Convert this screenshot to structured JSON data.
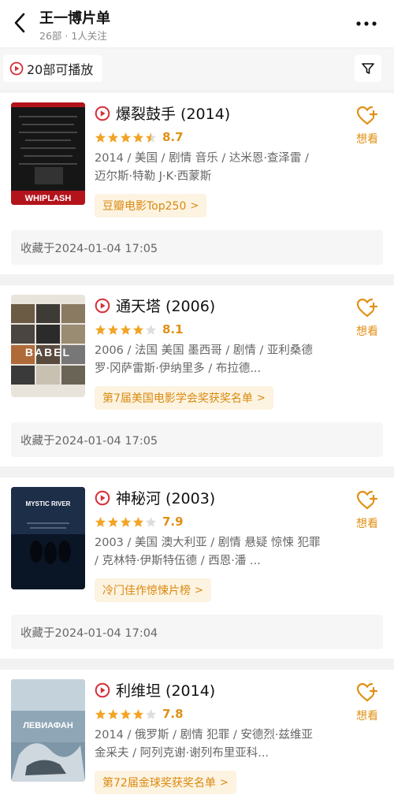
{
  "header": {
    "title": "王一博片单",
    "subtitle": "26部 · 1人关注"
  },
  "filter": {
    "play_count": "20部可播放"
  },
  "movies": [
    {
      "title": "爆裂鼓手 (2014)",
      "rating": 8.7,
      "stars": 4.5,
      "meta": "2014 / 美国 / 剧情 音乐 / 达米恩·查泽雷 / 迈尔斯·特勒 J·K·西蒙斯",
      "tag": "豆瓣电影Top250",
      "want_label": "想看",
      "collected": "收藏于2024-01-04 17:05",
      "poster_text": "WHIPLASH"
    },
    {
      "title": "通天塔 (2006)",
      "rating": 8.1,
      "stars": 4,
      "meta": "2006 / 法国 美国 墨西哥 / 剧情 / 亚利桑德罗·冈萨雷斯·伊纳里多 / 布拉德...",
      "tag": "第7届美国电影学会奖获奖名单",
      "want_label": "想看",
      "collected": "收藏于2024-01-04 17:05",
      "poster_text": "BABEL"
    },
    {
      "title": "神秘河 (2003)",
      "rating": 7.9,
      "stars": 4,
      "meta": "2003 / 美国 澳大利亚 / 剧情 悬疑 惊悚 犯罪 / 克林特·伊斯特伍德 / 西恩·潘 ...",
      "tag": "冷门佳作惊悚片榜",
      "want_label": "想看",
      "collected": "收藏于2024-01-04 17:04",
      "poster_text": "MYSTIC RIVER"
    },
    {
      "title": "利维坦 (2014)",
      "rating": 7.8,
      "stars": 4,
      "meta": "2014 / 俄罗斯 / 剧情 犯罪 / 安德烈·兹维亚金采夫 / 阿列克谢·谢列布里亚科...",
      "tag": "第72届金球奖获奖名单",
      "want_label": "想看",
      "collected": "",
      "poster_text": "ЛЕВИАФАН"
    }
  ],
  "colors": {
    "accent": "#e09015",
    "play_red": "#d6303a",
    "tag_bg": "#fdf3e1"
  }
}
